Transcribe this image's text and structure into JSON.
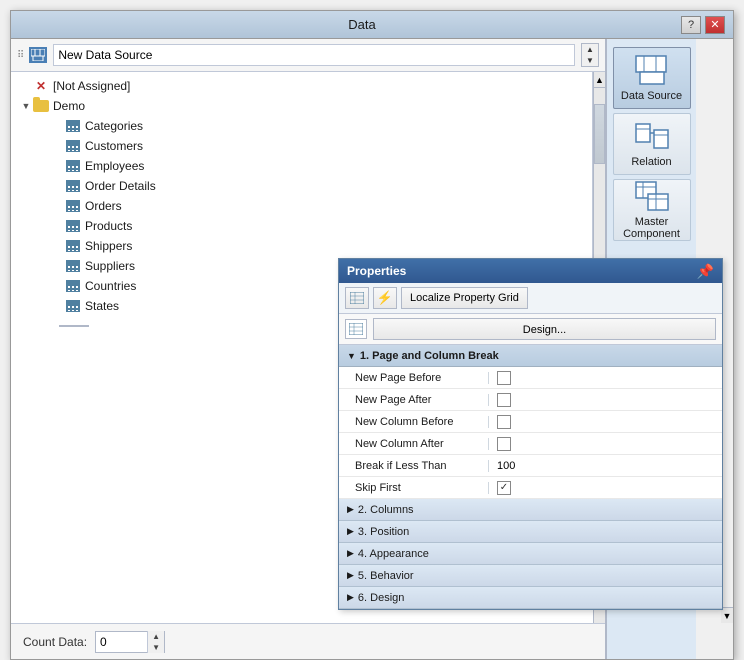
{
  "window": {
    "title": "Data",
    "help_label": "?",
    "close_label": "✕"
  },
  "datasource": {
    "label": "New Data Source",
    "count_label": "Count Data:",
    "count_value": "0"
  },
  "tree": {
    "not_assigned": "[Not Assigned]",
    "demo_label": "Demo",
    "items": [
      {
        "label": "Categories",
        "indent": 3
      },
      {
        "label": "Customers",
        "indent": 3
      },
      {
        "label": "Employees",
        "indent": 3
      },
      {
        "label": "Order Details",
        "indent": 3
      },
      {
        "label": "Orders",
        "indent": 3
      },
      {
        "label": "Products",
        "indent": 3
      },
      {
        "label": "Shippers",
        "indent": 3
      },
      {
        "label": "Suppliers",
        "indent": 3
      },
      {
        "label": "Countries",
        "indent": 3
      },
      {
        "label": "States",
        "indent": 3
      }
    ]
  },
  "toolbar": {
    "datasource_label": "Data Source",
    "relation_label": "Relation",
    "master_label": "Master Component"
  },
  "properties": {
    "title": "Properties",
    "pin_symbol": "📌",
    "localize_btn": "Localize Property Grid",
    "design_btn": "Design...",
    "sections": [
      {
        "label": "1. Page and Column Break",
        "expanded": true,
        "rows": [
          {
            "label": "New Page Before",
            "type": "checkbox",
            "checked": false
          },
          {
            "label": "New Page After",
            "type": "checkbox",
            "checked": false
          },
          {
            "label": "New Column Before",
            "type": "checkbox",
            "checked": false
          },
          {
            "label": "New Column After",
            "type": "checkbox",
            "checked": false
          },
          {
            "label": "Break if Less Than",
            "type": "value",
            "value": "100"
          },
          {
            "label": "Skip First",
            "type": "checkbox",
            "checked": true
          }
        ]
      },
      {
        "label": "2. Columns",
        "expanded": false
      },
      {
        "label": "3. Position",
        "expanded": false
      },
      {
        "label": "4. Appearance",
        "expanded": false
      },
      {
        "label": "5. Behavior",
        "expanded": false
      },
      {
        "label": "6. Design",
        "expanded": false
      }
    ]
  }
}
